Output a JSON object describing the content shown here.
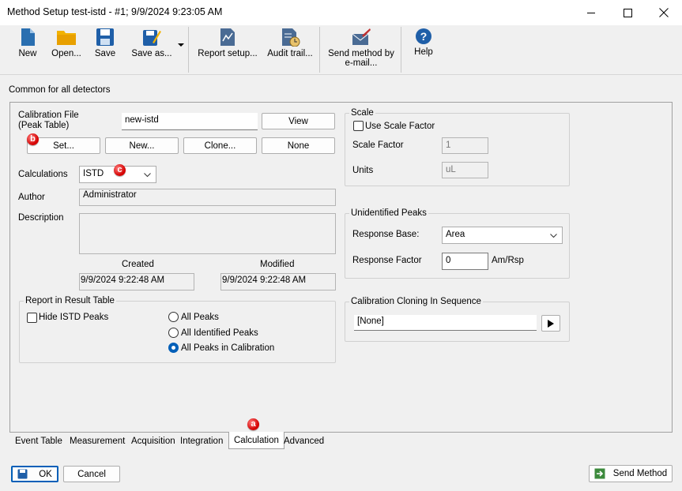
{
  "window": {
    "title": "Method Setup test-istd - #1;  9/9/2024  9:23:05 AM",
    "controls": [
      "minimize",
      "maximize",
      "close"
    ]
  },
  "toolbar": {
    "new": "New",
    "open": "Open...",
    "save": "Save",
    "save_as": "Save as...",
    "report_setup": "Report setup...",
    "audit_trail": "Audit trail...",
    "send_email_line1": "Send method by",
    "send_email_line2": "e-mail...",
    "help": "Help"
  },
  "section_header": "Common for all detectors",
  "calibration": {
    "label_line1": "Calibration File",
    "label_line2": "(Peak Table)",
    "file_value": "new-istd",
    "view_label": "View",
    "set_label": "Set...",
    "new_label": "New...",
    "clone_label": "Clone...",
    "none_label": "None"
  },
  "calculations": {
    "label": "Calculations",
    "value": "ISTD"
  },
  "author": {
    "label": "Author",
    "value": "Administrator"
  },
  "description": {
    "label": "Description",
    "value": ""
  },
  "dates": {
    "created_label": "Created",
    "created_value": "9/9/2024 9:22:48 AM",
    "modified_label": "Modified",
    "modified_value": "9/9/2024 9:22:48 AM"
  },
  "report": {
    "title": "Report in Result Table",
    "hide_istd_label": "Hide ISTD Peaks",
    "hide_istd_checked": false,
    "options": [
      "All Peaks",
      "All Identified Peaks",
      "All Peaks in Calibration"
    ],
    "selected_index": 2
  },
  "scale": {
    "title": "Scale",
    "use_scale_label": "Use Scale Factor",
    "use_scale_checked": false,
    "factor_label": "Scale Factor",
    "factor_value": "1",
    "units_label": "Units",
    "units_value": "uL"
  },
  "unidentified": {
    "title": "Unidentified Peaks",
    "response_base_label": "Response Base:",
    "response_base_value": "Area",
    "response_factor_label": "Response Factor",
    "response_factor_value": "0",
    "response_factor_unit": "Am/Rsp"
  },
  "cloning": {
    "title": "Calibration Cloning In Sequence",
    "value": "[None]"
  },
  "tabs": [
    "Event Table",
    "Measurement",
    "Acquisition",
    "Integration",
    "Calculation",
    "Advanced"
  ],
  "active_tab": "Calculation",
  "markers": {
    "a": "a",
    "b": "b",
    "c": "c"
  },
  "footer": {
    "ok": "OK",
    "cancel": "Cancel",
    "send_method": "Send Method"
  },
  "colors": {
    "accent": "#005fb8",
    "marker": "#d40000",
    "icon_blue": "#2a6fb0",
    "icon_yellow": "#f2b200"
  }
}
